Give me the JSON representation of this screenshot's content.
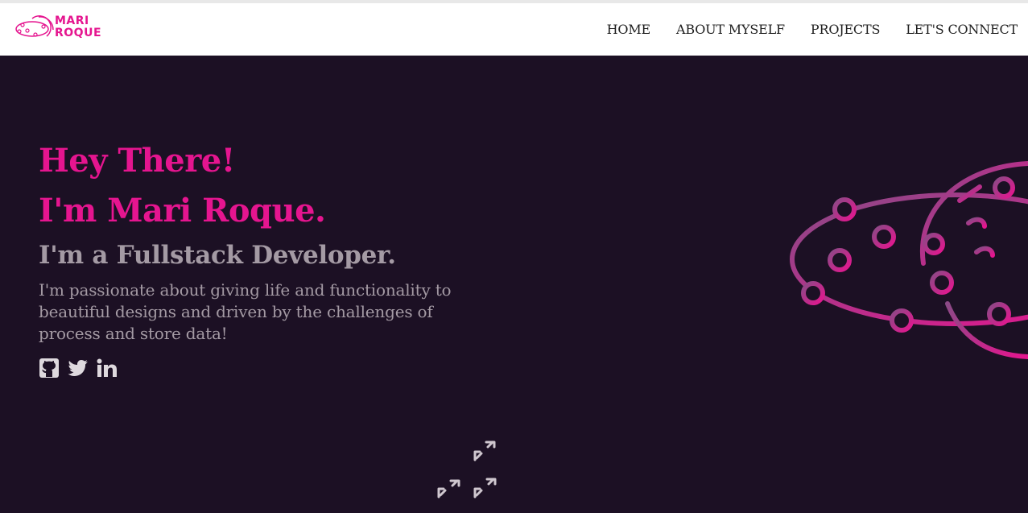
{
  "brand": {
    "logo_lines": [
      "MARI",
      "ROQUE"
    ],
    "accent_color": "#e5158f",
    "background_color": "#1c1024"
  },
  "nav": {
    "items": [
      {
        "label": "HOME"
      },
      {
        "label": "ABOUT MYSELF"
      },
      {
        "label": "PROJECTS"
      },
      {
        "label": "LET'S CONNECT"
      }
    ]
  },
  "hero": {
    "greeting": "Hey There!",
    "name_line": "I'm Mari Roque.",
    "role": "I'm a Fullstack Developer.",
    "blurb": "I'm passionate about giving life and functionality to beautiful designs and driven by the challenges of process and store data!"
  },
  "socials": [
    {
      "icon": "github-icon"
    },
    {
      "icon": "twitter-icon"
    },
    {
      "icon": "linkedin-icon"
    }
  ],
  "decorations": {
    "planet_icon": "planet-network-icon",
    "scroll_icon": "scroll-down-arrows-icon"
  }
}
